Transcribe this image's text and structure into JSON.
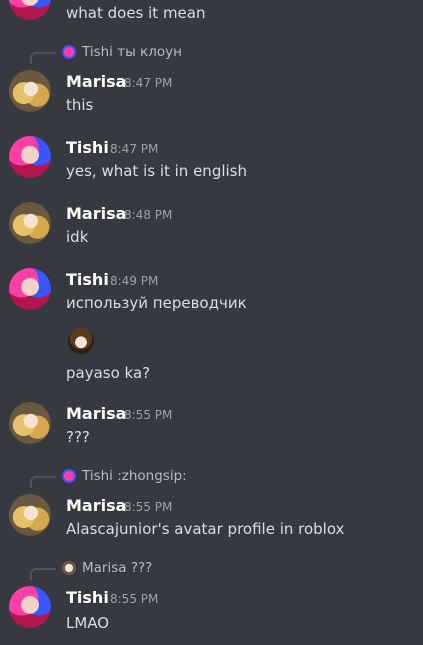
{
  "messages": [
    {
      "type": "text",
      "text": "what does it mean"
    },
    {
      "type": "reply",
      "reply_to_author": "Tishi",
      "reply_to_text": "ты клоун",
      "author": "Marisa",
      "time": "8:47 PM",
      "text": "this"
    },
    {
      "type": "msg",
      "author": "Tishi",
      "time": "8:47 PM",
      "text": "yes, what is it in english"
    },
    {
      "type": "msg",
      "author": "Marisa",
      "time": "8:48 PM",
      "text": "idk"
    },
    {
      "type": "msg",
      "author": "Tishi",
      "time": "8:49 PM",
      "text": "используй переводчик",
      "emoji": "custom-emoji",
      "text2": "payaso ka?"
    },
    {
      "type": "msg",
      "author": "Marisa",
      "time": "8:55 PM",
      "text": "???"
    },
    {
      "type": "reply",
      "reply_to_author": "Tishi",
      "reply_to_text": ":zhongsip:",
      "author": "Marisa",
      "time": "8:55 PM",
      "text": "Alascajunior's avatar profile in roblox"
    },
    {
      "type": "reply",
      "reply_to_author": "Marisa",
      "reply_to_text": "???",
      "author": "Tishi",
      "time": "8:55 PM",
      "text": "LMAO"
    }
  ]
}
